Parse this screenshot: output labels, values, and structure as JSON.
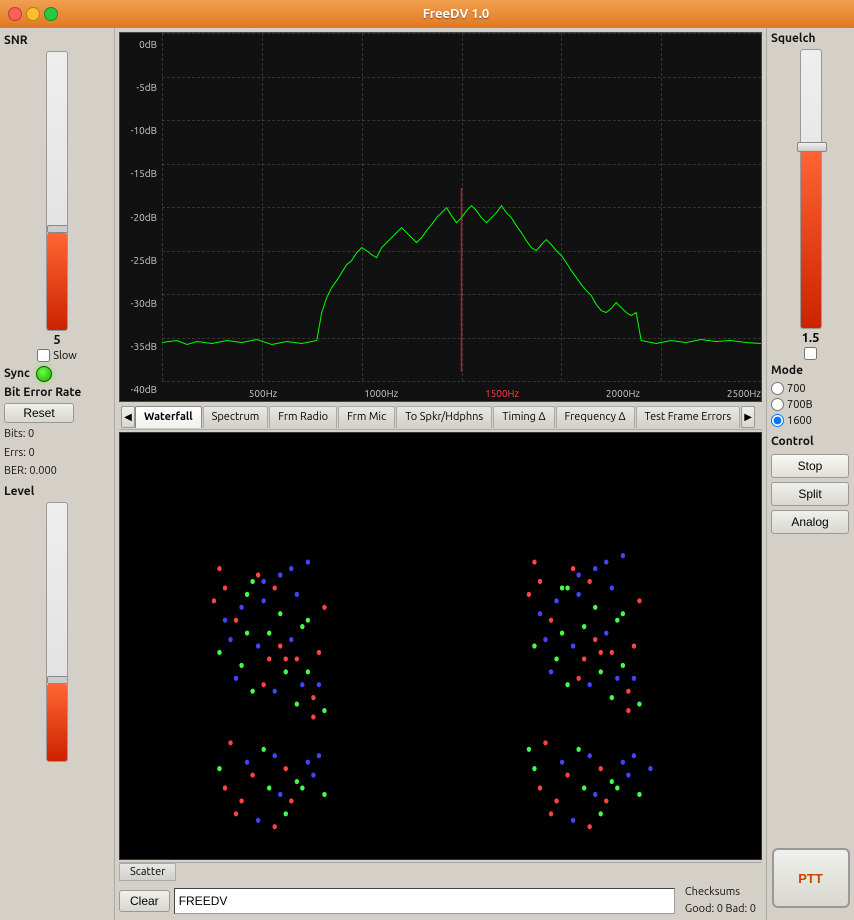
{
  "titlebar": {
    "title": "FreeDV 1.0"
  },
  "left_panel": {
    "snr_label": "SNR",
    "snr_value": "5",
    "slow_label": "Slow",
    "sync_label": "Sync",
    "sync_active": true,
    "ber_label": "Bit Error Rate",
    "reset_label": "Reset",
    "bits_label": "Bits: 0",
    "errs_label": "Errs: 0",
    "ber_label_val": "BER: 0.000",
    "level_label": "Level"
  },
  "spectrum": {
    "db_labels": [
      "0dB",
      "-5dB",
      "-10dB",
      "-15dB",
      "-20dB",
      "-25dB",
      "-30dB",
      "-35dB",
      "-40dB"
    ],
    "freq_labels": [
      "",
      "500Hz",
      "1000Hz",
      "1500Hz",
      "2000Hz",
      "2500Hz"
    ]
  },
  "tabs": [
    {
      "label": "Waterfall",
      "active": false
    },
    {
      "label": "Spectrum",
      "active": false
    },
    {
      "label": "Frm Radio",
      "active": false
    },
    {
      "label": "Frm Mic",
      "active": false
    },
    {
      "label": "To Spkr/Hdphns",
      "active": false
    },
    {
      "label": "Timing Δ",
      "active": false
    },
    {
      "label": "Frequency Δ",
      "active": false
    },
    {
      "label": "Test Frame Errors",
      "active": false
    }
  ],
  "scatter_tab": "Scatter",
  "text_row": {
    "clear_label": "Clear",
    "input_value": "FREEDV",
    "checksums_label": "Checksums",
    "good_label": "Good: 0",
    "bad_label": "Bad: 0"
  },
  "right_panel": {
    "squelch_label": "Squelch",
    "squelch_value": "1.5",
    "mode_label": "Mode",
    "mode_options": [
      "700",
      "700B",
      "1600"
    ],
    "control_label": "Control",
    "stop_label": "Stop",
    "split_label": "Split",
    "analog_label": "Analog",
    "ptt_label": "PTT"
  }
}
